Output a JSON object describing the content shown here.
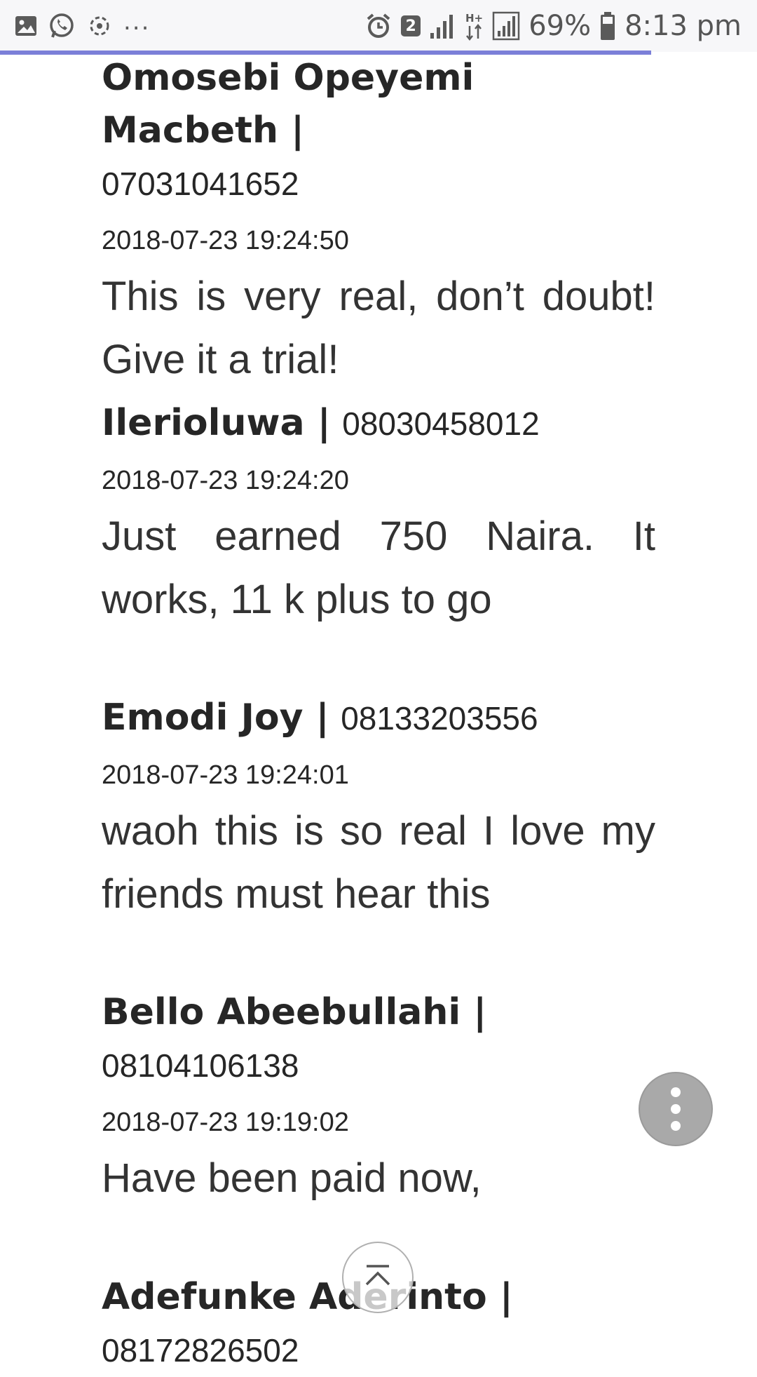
{
  "status_bar": {
    "left_icons": [
      "gallery-icon",
      "whatsapp-icon",
      "sync-icon"
    ],
    "overflow": "...",
    "sim_badge": "2",
    "network": "H+",
    "battery": "69%",
    "time": "8:13 pm"
  },
  "page_load_progress": 0.86,
  "comments": [
    {
      "author": "Omosebi Opeyemi Macbeth |",
      "phone": "07031041652",
      "timestamp": "2018-07-23 19:24:50",
      "text": "This is very real, don’t doubt! Give it a trial!"
    },
    {
      "author": "Ilerioluwa |",
      "phone": "08030458012",
      "timestamp": "2018-07-23 19:24:20",
      "text": "Just earned 750 Naira. It works, 11 k plus to go"
    },
    {
      "author": "Emodi Joy |",
      "phone": "08133203556",
      "timestamp": "2018-07-23 19:24:01",
      "text": "waoh this is so real I love my friends must hear this"
    },
    {
      "author": "Bello Abeebullahi |",
      "phone": "08104106138",
      "timestamp": "2018-07-23 19:19:02",
      "text": "Have been paid now,"
    },
    {
      "author": "Adefunke Aderinto |",
      "phone": "08172826502",
      "timestamp": "",
      "text": ""
    }
  ],
  "colors": {
    "progress": "#7b7fd8",
    "fab": "#a9a9a9",
    "text": "#262626"
  }
}
